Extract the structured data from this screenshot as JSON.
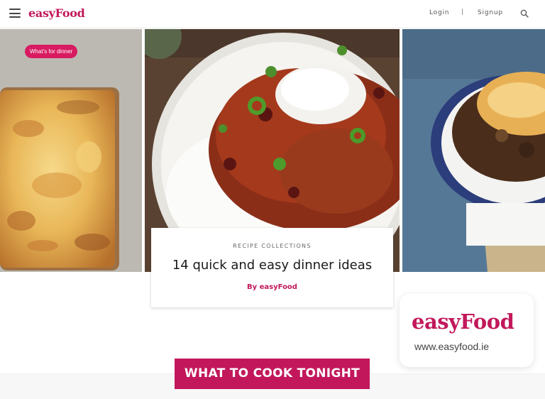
{
  "header": {
    "logo": "easyFood",
    "login_label": "Login",
    "separator": "|",
    "signup_label": "Signup"
  },
  "hero": {
    "tag_label": "What's for dinner",
    "card": {
      "kicker": "RECIPE COLLECTIONS",
      "title": "14 quick and easy dinner ideas",
      "author": "By easyFood"
    }
  },
  "badge": {
    "logo": "easyFood",
    "url": "www.easyfood.ie"
  },
  "cta": {
    "label": "WHAT TO COOK TONIGHT"
  },
  "colors": {
    "brand": "#c2185b",
    "tag": "#d81b60"
  },
  "icons": [
    "menu-icon",
    "search-icon"
  ]
}
